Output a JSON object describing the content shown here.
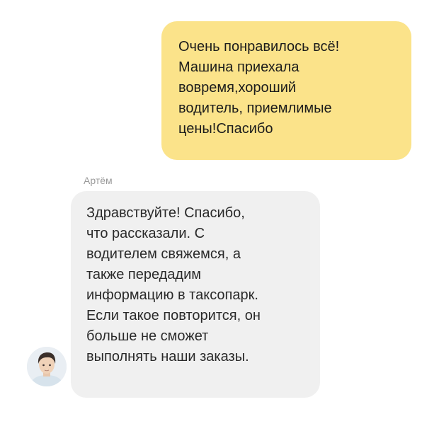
{
  "messages": {
    "outgoing": {
      "text": "Очень понравилось всё!\nМашина приехала\nвовремя,хороший\nводитель, приемлимые\nцены!Спасибо"
    },
    "incoming": {
      "sender": "Артём",
      "text": "Здравствуйте! Спасибо,\nчто рассказали. С\nводителем свяжемся, а\nтакже передадим\nинформацию в таксопарк.\nЕсли такое повторится, он\nбольше не сможет\nвыполнять наши заказы.",
      "avatar_icon": "person-avatar-icon"
    }
  },
  "colors": {
    "outgoing_bubble": "#fbe38a",
    "incoming_bubble": "#f0f0f0",
    "sender_name": "#9a9a9a"
  }
}
